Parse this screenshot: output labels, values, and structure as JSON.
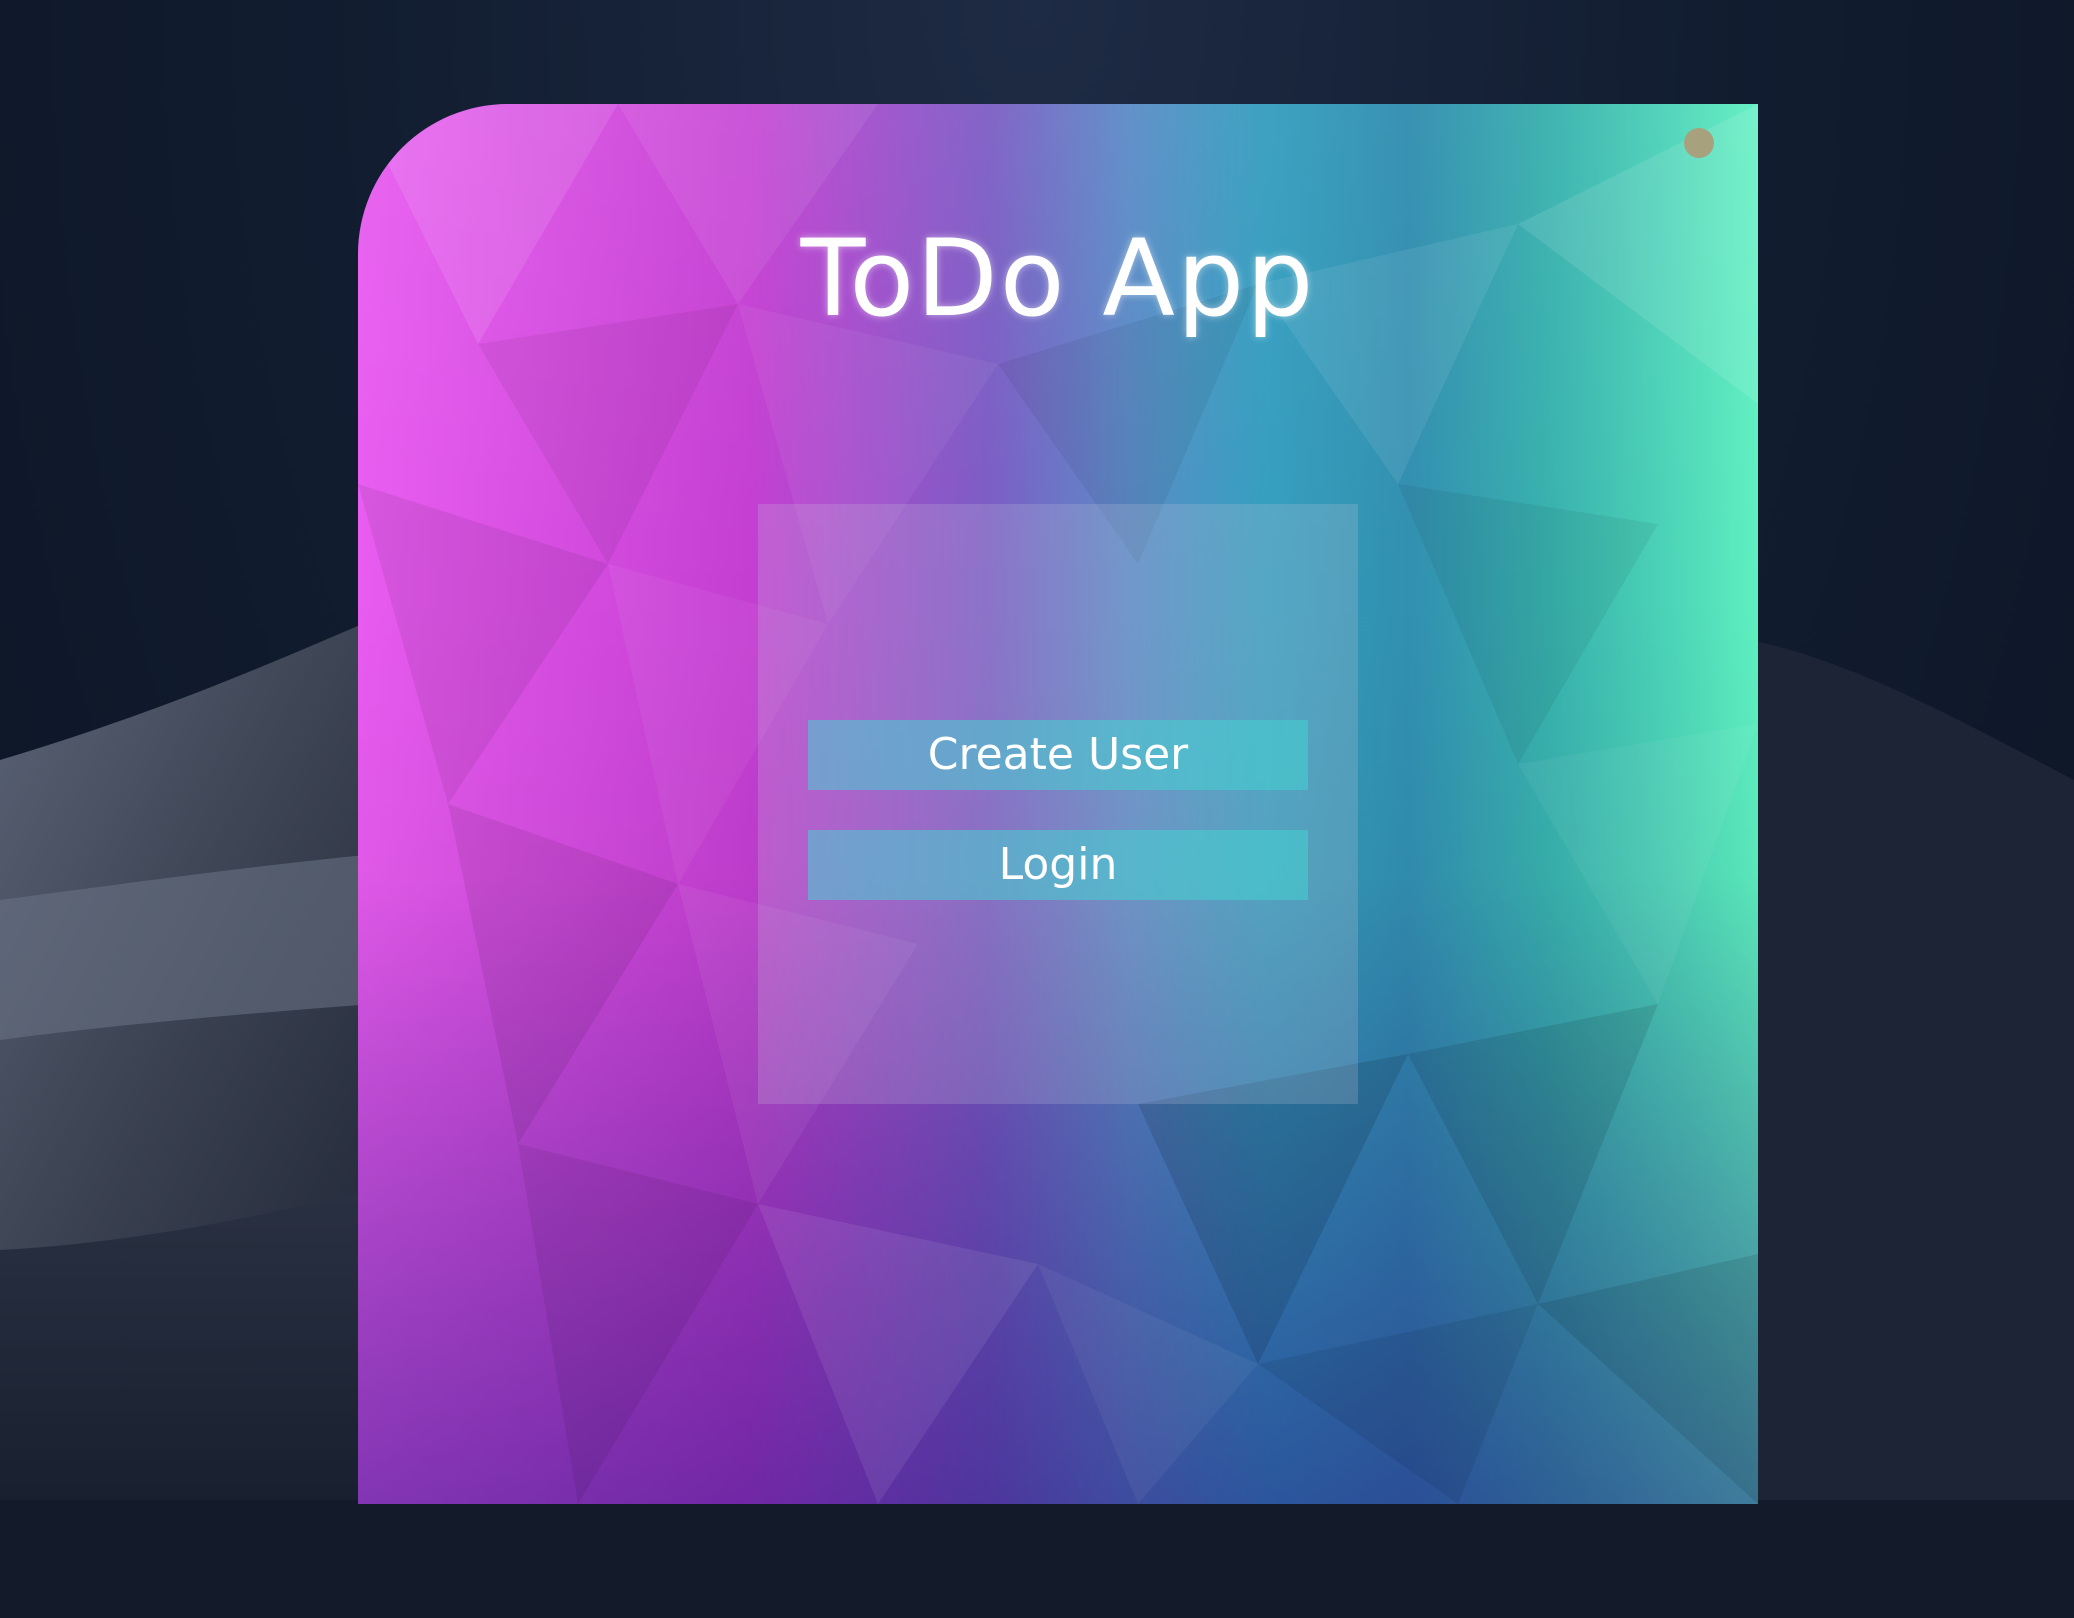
{
  "app": {
    "title": "ToDo App"
  },
  "buttons": {
    "create_user": "Create User",
    "login": "Login"
  },
  "colors": {
    "close_dot": "#a8a17e",
    "title_text": "#ffffff",
    "button_bg": "#46d2d2"
  },
  "icons": {
    "close": "close-dot-icon"
  }
}
